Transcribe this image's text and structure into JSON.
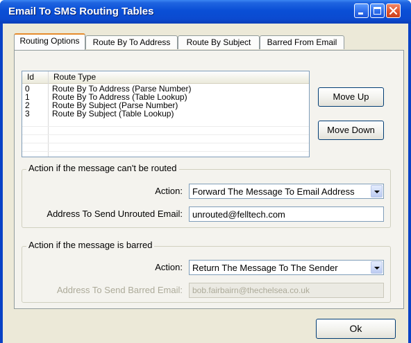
{
  "window": {
    "title": "Email To SMS Routing Tables"
  },
  "tabs": [
    {
      "label": "Routing Options",
      "active": true
    },
    {
      "label": "Route By To Address",
      "active": false
    },
    {
      "label": "Route By Subject",
      "active": false
    },
    {
      "label": "Barred From Email",
      "active": false
    }
  ],
  "route_list": {
    "columns": [
      "Id",
      "Route Type"
    ],
    "rows": [
      {
        "id": "0",
        "type": "Route By To Address (Parse Number)"
      },
      {
        "id": "1",
        "type": "Route By To Address (Table Lookup)"
      },
      {
        "id": "2",
        "type": "Route By Subject (Parse Number)"
      },
      {
        "id": "3",
        "type": "Route By Subject (Table Lookup)"
      }
    ]
  },
  "buttons": {
    "move_up": "Move Up",
    "move_down": "Move Down",
    "ok": "Ok"
  },
  "unrouted_group": {
    "legend": "Action if the message can't be routed",
    "action_label": "Action:",
    "action_value": "Forward The Message To Email Address",
    "address_label": "Address To Send Unrouted Email:",
    "address_value": "unrouted@felltech.com"
  },
  "barred_group": {
    "legend": "Action if the message is barred",
    "action_label": "Action:",
    "action_value": "Return The Message To The Sender",
    "address_label": "Address To Send Barred Email:",
    "address_value": "bob.fairbairn@thechelsea.co.uk"
  },
  "colors": {
    "titlebar": "#0a4fd6",
    "dialog_face": "#ece9d8",
    "tab_accent": "#e68b2c"
  }
}
